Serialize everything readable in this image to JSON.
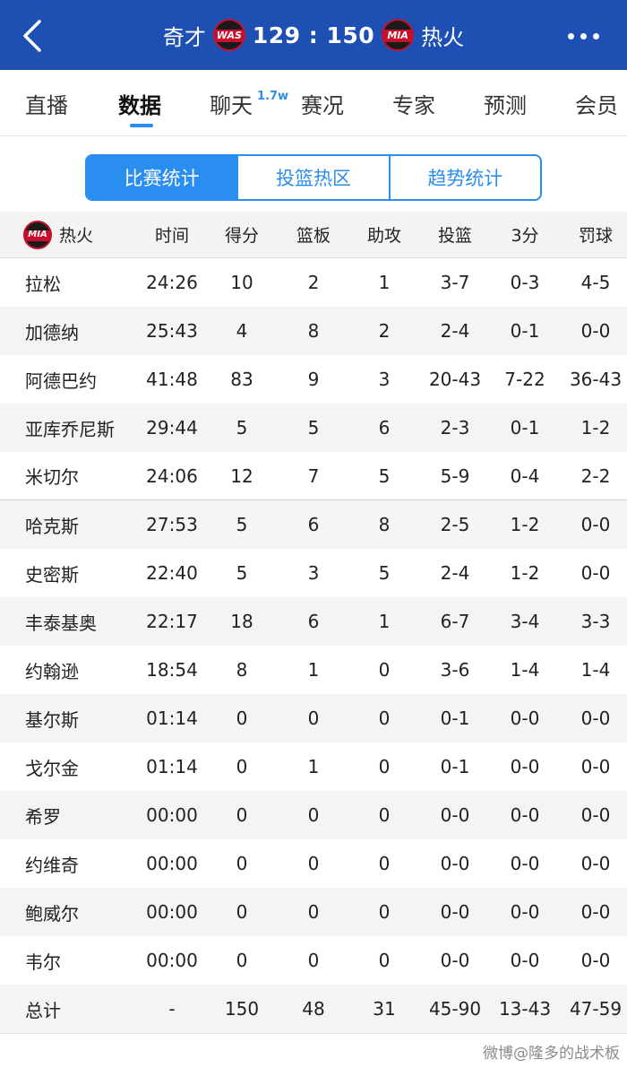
{
  "header": {
    "home_team": "奇才",
    "home_logo": "WAS",
    "score": "129 : 150",
    "away_logo": "MIA",
    "away_team": "热火",
    "back_icon": "chevron-left-icon",
    "more_icon": "more-dots-icon"
  },
  "nav": {
    "tabs": [
      "直播",
      "数据",
      "聊天",
      "赛况",
      "专家",
      "预测",
      "会员"
    ],
    "chat_badge": "1.7w",
    "active": "数据"
  },
  "segments": [
    "比赛统计",
    "投篮热区",
    "趋势统计"
  ],
  "table": {
    "team_logo": "MIA",
    "team_name": "热火",
    "columns": [
      "时间",
      "得分",
      "篮板",
      "助攻",
      "投篮",
      "3分",
      "罚球"
    ],
    "rows": [
      [
        "拉松",
        "24:26",
        "10",
        "2",
        "1",
        "3-7",
        "0-3",
        "4-5"
      ],
      [
        "加德纳",
        "25:43",
        "4",
        "8",
        "2",
        "2-4",
        "0-1",
        "0-0"
      ],
      [
        "阿德巴约",
        "41:48",
        "83",
        "9",
        "3",
        "20-43",
        "7-22",
        "36-43"
      ],
      [
        "亚库乔尼斯",
        "29:44",
        "5",
        "5",
        "6",
        "2-3",
        "0-1",
        "1-2"
      ],
      [
        "米切尔",
        "24:06",
        "12",
        "7",
        "5",
        "5-9",
        "0-4",
        "2-2"
      ],
      [
        "哈克斯",
        "27:53",
        "5",
        "6",
        "8",
        "2-5",
        "1-2",
        "0-0"
      ],
      [
        "史密斯",
        "22:40",
        "5",
        "3",
        "5",
        "2-4",
        "1-2",
        "0-0"
      ],
      [
        "丰泰基奥",
        "22:17",
        "18",
        "6",
        "1",
        "6-7",
        "3-4",
        "3-3"
      ],
      [
        "约翰逊",
        "18:54",
        "8",
        "1",
        "0",
        "3-6",
        "1-4",
        "1-4"
      ],
      [
        "基尔斯",
        "01:14",
        "0",
        "0",
        "0",
        "0-1",
        "0-0",
        "0-0"
      ],
      [
        "戈尔金",
        "01:14",
        "0",
        "1",
        "0",
        "0-1",
        "0-0",
        "0-0"
      ],
      [
        "希罗",
        "00:00",
        "0",
        "0",
        "0",
        "0-0",
        "0-0",
        "0-0"
      ],
      [
        "约维奇",
        "00:00",
        "0",
        "0",
        "0",
        "0-0",
        "0-0",
        "0-0"
      ],
      [
        "鲍威尔",
        "00:00",
        "0",
        "0",
        "0",
        "0-0",
        "0-0",
        "0-0"
      ],
      [
        "韦尔",
        "00:00",
        "0",
        "0",
        "0",
        "0-0",
        "0-0",
        "0-0"
      ]
    ],
    "totals": [
      "总计",
      "-",
      "150",
      "48",
      "31",
      "45-90",
      "13-43",
      "47-59"
    ]
  },
  "watermark": "微博@隆多的战术板",
  "colors": {
    "header_bg": "#1e50b4",
    "accent": "#2a8df0",
    "logo_red": "#c8102e"
  }
}
